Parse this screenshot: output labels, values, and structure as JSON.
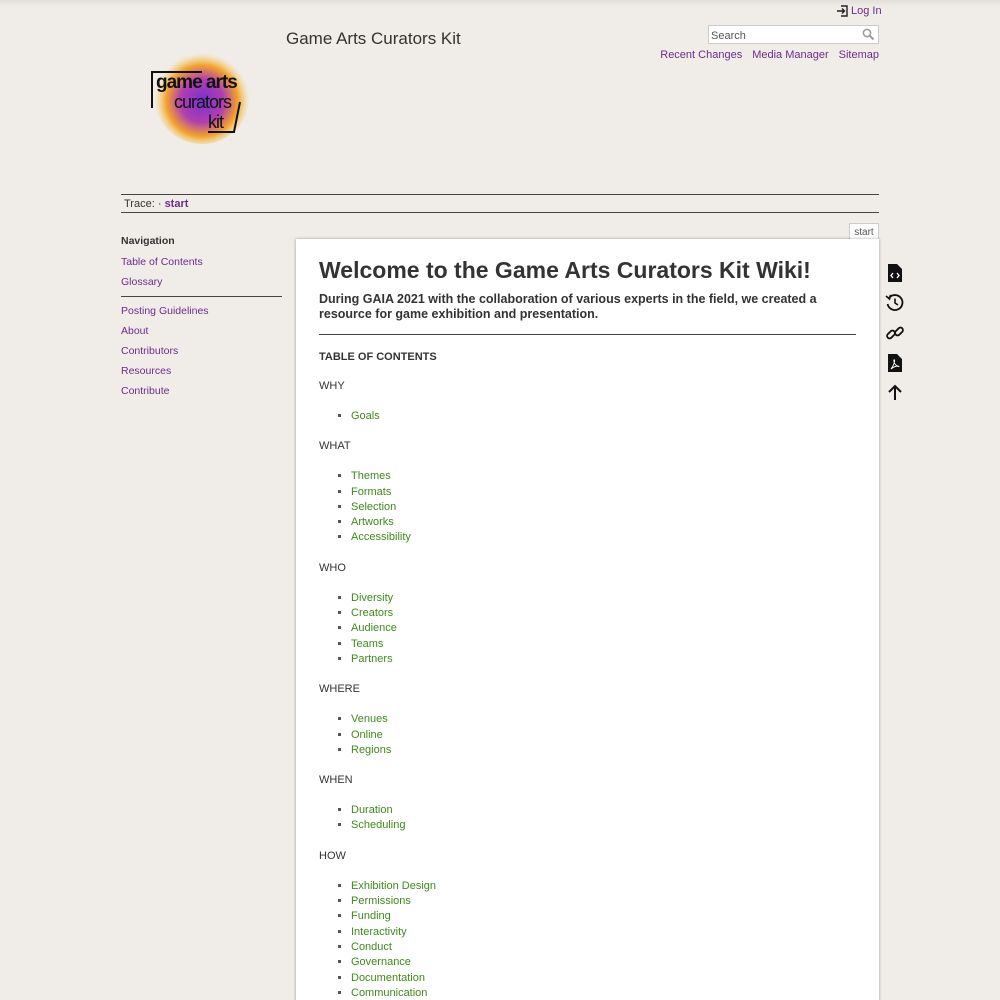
{
  "header": {
    "site_title": "Game Arts Curators Kit",
    "logo_text": [
      "game arts",
      "curators",
      "kit"
    ],
    "login_label": "Log In",
    "search_placeholder": "Search",
    "tools": [
      "Recent Changes",
      "Media Manager",
      "Sitemap"
    ]
  },
  "trace": {
    "label": "Trace:",
    "separator": "·",
    "current": "start"
  },
  "sidebar": {
    "title": "Navigation",
    "group1": [
      "Table of Contents",
      "Glossary"
    ],
    "group2": [
      "Posting Guidelines",
      "About",
      "Contributors",
      "Resources",
      "Contribute"
    ]
  },
  "page": {
    "tab_label": "start",
    "title": "Welcome to the Game Arts Curators Kit Wiki!",
    "intro": "During GAIA 2021 with the collaboration of various experts in the field, we created a resource for game exhibition and presentation.",
    "toc_heading": "TABLE OF CONTENTS",
    "sections": [
      {
        "label": "WHY",
        "items": [
          "Goals"
        ]
      },
      {
        "label": "WHAT",
        "items": [
          "Themes",
          "Formats",
          "Selection",
          "Artworks",
          "Accessibility"
        ]
      },
      {
        "label": "WHO",
        "items": [
          "Diversity",
          "Creators",
          "Audience",
          "Teams",
          "Partners"
        ]
      },
      {
        "label": "WHERE",
        "items": [
          "Venues",
          "Online",
          "Regions"
        ]
      },
      {
        "label": "WHEN",
        "items": [
          "Duration",
          "Scheduling"
        ]
      },
      {
        "label": "HOW",
        "items": [
          "Exhibition Design",
          "Permissions",
          "Funding",
          "Interactivity",
          "Conduct",
          "Governance",
          "Documentation",
          "Communication"
        ]
      }
    ]
  },
  "page_tools": [
    "show-source-icon",
    "old-revisions-icon",
    "backlinks-icon",
    "export-pdf-icon",
    "back-to-top-icon"
  ],
  "colors": {
    "background": "#f0ede8",
    "nav_link": "#6a2c8c",
    "content_link": "#3f8a1a"
  }
}
